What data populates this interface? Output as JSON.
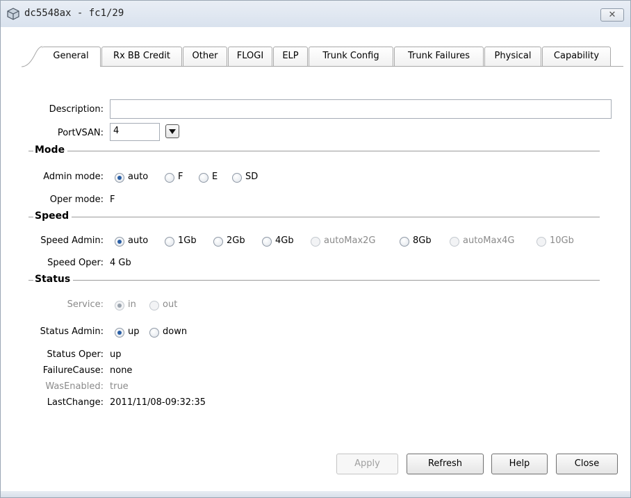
{
  "window": {
    "title": "dc5548ax - fc1/29",
    "close_glyph": "✕"
  },
  "tabs": [
    {
      "label": "General",
      "active": true
    },
    {
      "label": "Rx BB Credit",
      "active": false
    },
    {
      "label": "Other",
      "active": false
    },
    {
      "label": "FLOGI",
      "active": false
    },
    {
      "label": "ELP",
      "active": false
    },
    {
      "label": "Trunk Config",
      "active": false
    },
    {
      "label": "Trunk Failures",
      "active": false
    },
    {
      "label": "Physical",
      "active": false
    },
    {
      "label": "Capability",
      "active": false
    }
  ],
  "general": {
    "description_label": "Description:",
    "description_value": "",
    "portvsan_label": "PortVSAN:",
    "portvsan_value": "4",
    "mode": {
      "section_title": "Mode",
      "admin_label": "Admin mode:",
      "admin_options": [
        {
          "label": "auto",
          "checked": true,
          "enabled": true
        },
        {
          "label": "F",
          "checked": false,
          "enabled": true
        },
        {
          "label": "E",
          "checked": false,
          "enabled": true
        },
        {
          "label": "SD",
          "checked": false,
          "enabled": true
        }
      ],
      "oper_label": "Oper mode:",
      "oper_value": "F"
    },
    "speed": {
      "section_title": "Speed",
      "admin_label": "Speed Admin:",
      "admin_options": [
        {
          "label": "auto",
          "checked": true,
          "enabled": true
        },
        {
          "label": "1Gb",
          "checked": false,
          "enabled": true
        },
        {
          "label": "2Gb",
          "checked": false,
          "enabled": true
        },
        {
          "label": "4Gb",
          "checked": false,
          "enabled": true
        },
        {
          "label": "autoMax2G",
          "checked": false,
          "enabled": false
        },
        {
          "label": "8Gb",
          "checked": false,
          "enabled": true
        },
        {
          "label": "autoMax4G",
          "checked": false,
          "enabled": false
        },
        {
          "label": "10Gb",
          "checked": false,
          "enabled": false
        }
      ],
      "oper_label": "Speed Oper:",
      "oper_value": "4 Gb"
    },
    "status": {
      "section_title": "Status",
      "service_label": "Service:",
      "service_options": [
        {
          "label": "in",
          "checked": true,
          "enabled": false
        },
        {
          "label": "out",
          "checked": false,
          "enabled": false
        }
      ],
      "admin_label": "Status Admin:",
      "admin_options": [
        {
          "label": "up",
          "checked": true,
          "enabled": true
        },
        {
          "label": "down",
          "checked": false,
          "enabled": true
        }
      ],
      "oper_label": "Status Oper:",
      "oper_value": "up",
      "failure_label": "FailureCause:",
      "failure_value": "none",
      "wasenabled_label": "WasEnabled:",
      "wasenabled_value": "true",
      "lastchange_label": "LastChange:",
      "lastchange_value": "2011/11/08-09:32:35"
    }
  },
  "buttons": {
    "apply": {
      "label": "Apply",
      "enabled": false
    },
    "refresh": {
      "label": "Refresh",
      "enabled": true
    },
    "help": {
      "label": "Help",
      "enabled": true
    },
    "close": {
      "label": "Close",
      "enabled": true
    }
  },
  "icons": {
    "window_icon": "switch-chassis-icon",
    "dropdown_icon": "triangle-down-icon",
    "close_icon": "close-icon"
  }
}
